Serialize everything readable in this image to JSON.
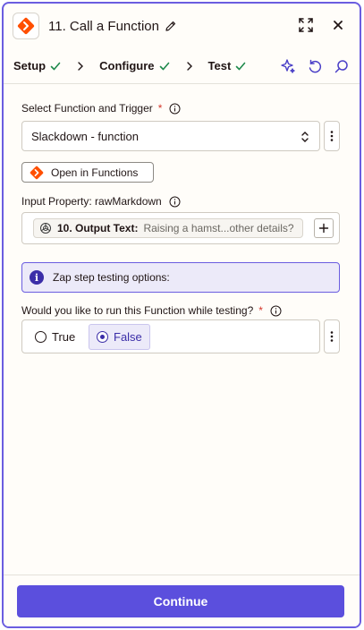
{
  "header": {
    "title": "11. Call a Function",
    "icons": {
      "logo": "functions-logo-icon",
      "edit": "pencil-icon",
      "expand": "expand-icon",
      "close": "close-icon"
    }
  },
  "tabs": [
    {
      "label": "Setup",
      "complete": true
    },
    {
      "label": "Configure",
      "complete": true
    },
    {
      "label": "Test",
      "complete": true
    }
  ],
  "tab_tools": [
    "sparkle-icon",
    "undo-icon",
    "search-icon"
  ],
  "fields": {
    "function": {
      "label": "Select Function and Trigger",
      "required_mark": "*",
      "value": "Slackdown - function"
    },
    "open_button": {
      "label": "Open in Functions"
    },
    "input_property": {
      "label": "Input Property: rawMarkdown",
      "pill_step": "10. Output Text:",
      "pill_value": "Raising a hamst...other details?"
    },
    "alert": {
      "icon_glyph": "i",
      "text": "Zap step testing options:"
    },
    "run_while_testing": {
      "label": "Would you like to run this Function while testing?",
      "required_mark": "*",
      "options": [
        {
          "label": "True",
          "selected": false
        },
        {
          "label": "False",
          "selected": true
        }
      ]
    }
  },
  "footer": {
    "continue_label": "Continue"
  },
  "colors": {
    "accent": "#5b4fdd",
    "brand_orange": "#ff4f00",
    "check_green": "#1f8a4c",
    "required_red": "#d5372a"
  }
}
